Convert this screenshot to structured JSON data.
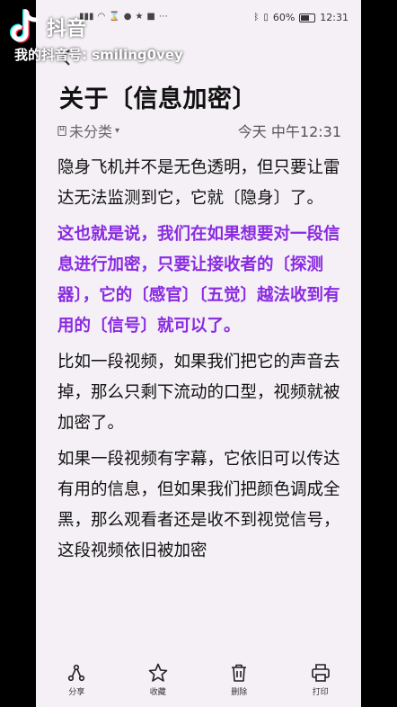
{
  "status": {
    "battery": "60%",
    "time": "12:31",
    "battery_level": 0.6
  },
  "overlay": {
    "app_name": "抖音",
    "douyin_id": "我的抖音号: smiling0vey"
  },
  "note": {
    "title": "关于〔信息加密〕",
    "category": "未分类",
    "time": "今天 中午12:31",
    "paragraphs": [
      {
        "text": "隐身飞机并不是无色透明，但只要让雷达无法监测到它，它就〔隐身〕了。",
        "highlight": false
      },
      {
        "text": "这也就是说，我们在如果想要对一段信息进行加密，只要让接收者的〔探测器〕，它的〔感官〕〔五觉〕越法收到有用的〔信号〕就可以了。",
        "highlight": true
      },
      {
        "text": "比如一段视频，如果我们把它的声音去掉，那么只剩下流动的口型，视频就被加密了。",
        "highlight": false
      },
      {
        "text": "如果一段视频有字幕，它依旧可以传达有用的信息，但如果我们把颜色调成全黑，那么观看者还是收不到视觉信号，这段视频依旧被加密",
        "highlight": false
      }
    ],
    "colors": {
      "highlight": "#8a2be2",
      "background": "#f4f0f5"
    }
  },
  "toolbar": {
    "share": "分享",
    "favorite": "收藏",
    "delete": "删除",
    "print": "打印"
  }
}
